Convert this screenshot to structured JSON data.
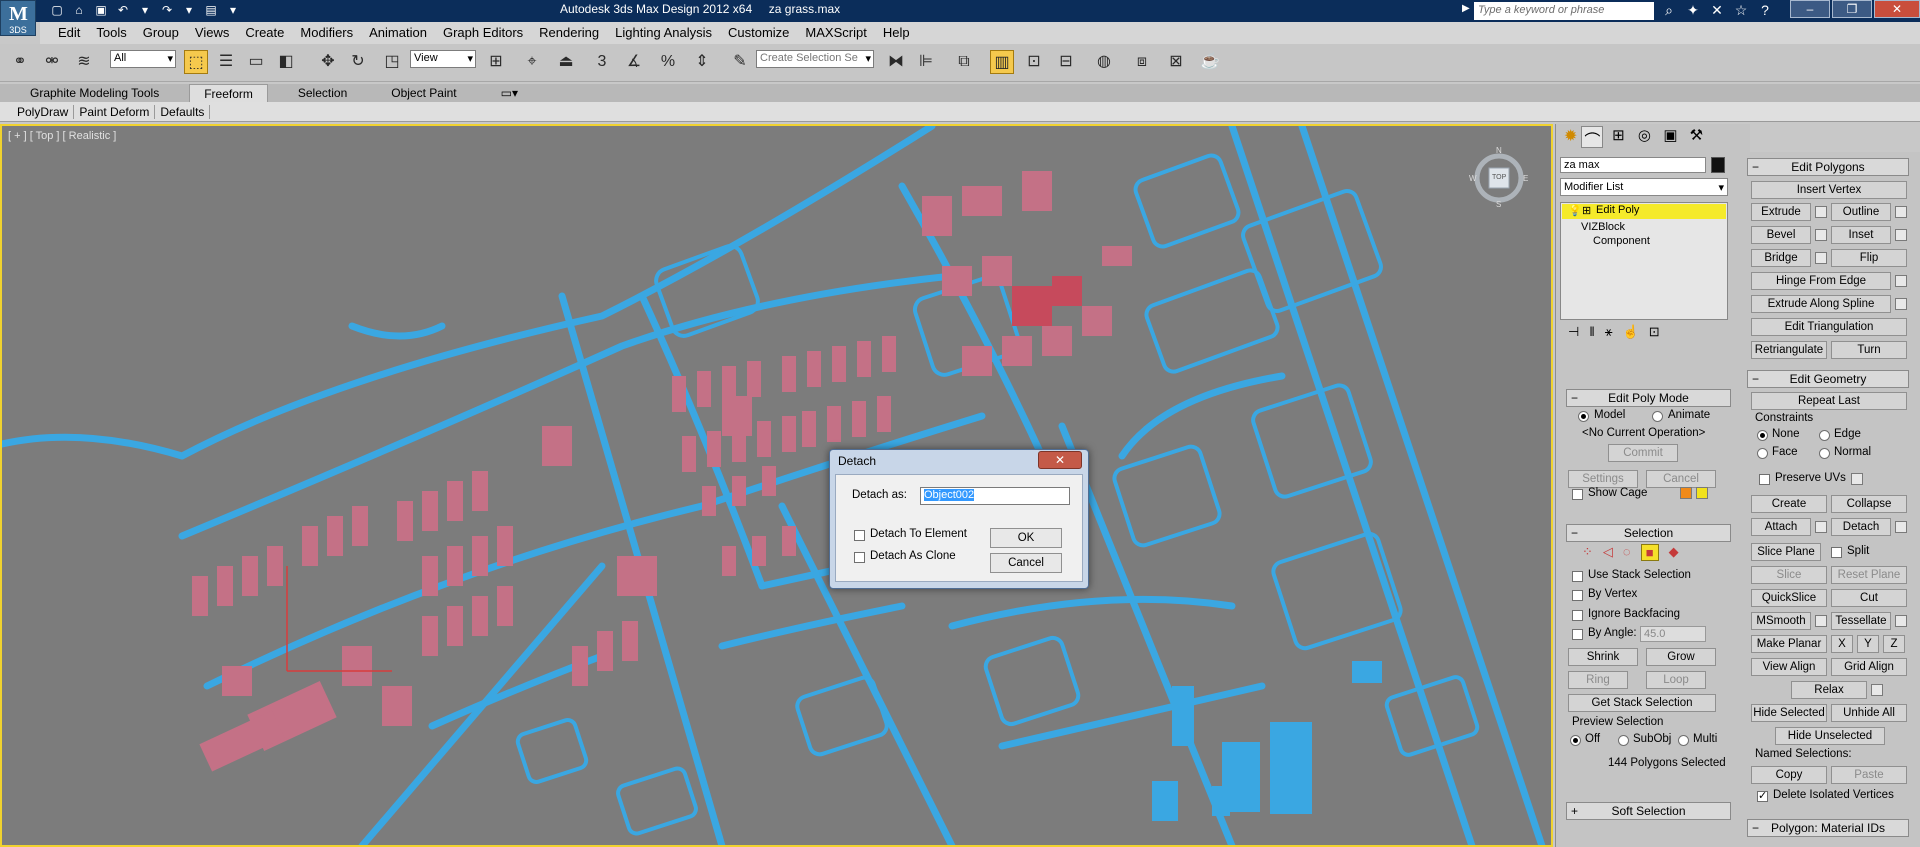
{
  "app": {
    "logo": "3DS",
    "title": "Autodesk 3ds Max Design 2012 x64     za grass.max"
  },
  "search": {
    "placeholder": "Type a keyword or phrase"
  },
  "menu": [
    "Edit",
    "Tools",
    "Group",
    "Views",
    "Create",
    "Modifiers",
    "Animation",
    "Graph Editors",
    "Rendering",
    "Lighting Analysis",
    "Customize",
    "MAXScript",
    "Help"
  ],
  "toolbar": {
    "filter": "All",
    "ref_coord": "View",
    "selection_set": "Create Selection Se",
    "snap_value": "3",
    "pct": "%"
  },
  "ribbon": {
    "tabs": [
      "Graphite Modeling Tools",
      "Freeform",
      "Selection",
      "Object Paint"
    ],
    "buttons": [
      "PolyDraw",
      "Paint Deform",
      "Defaults"
    ]
  },
  "viewport": {
    "label": "[ + ] [ Top ] [ Realistic ]",
    "viewcube_label": "TOP",
    "compass": [
      "N",
      "W",
      "E",
      "S"
    ]
  },
  "command_panel": {
    "object_name": "za max",
    "modifier_list": "Modifier List",
    "stack": [
      "Edit Poly",
      "VIZBlock",
      "Component"
    ],
    "edit_poly_mode": {
      "title": "Edit Poly Mode",
      "model": "Model",
      "animate": "Animate",
      "operation": "<No Current Operation>",
      "commit": "Commit",
      "settings": "Settings",
      "cancel": "Cancel",
      "show_cage": "Show Cage"
    },
    "selection": {
      "title": "Selection",
      "use_stack": "Use Stack Selection",
      "by_vertex": "By Vertex",
      "ignore_backfacing": "Ignore Backfacing",
      "by_angle": "By Angle:",
      "angle_value": "45.0",
      "shrink": "Shrink",
      "grow": "Grow",
      "ring": "Ring",
      "loop": "Loop",
      "get_stack": "Get Stack Selection",
      "preview": "Preview Selection",
      "off": "Off",
      "subobj": "SubObj",
      "multi": "Multi",
      "status": "144 Polygons Selected"
    },
    "soft_selection": "Soft Selection"
  },
  "edit_polygons": {
    "title": "Edit Polygons",
    "insert_vertex": "Insert Vertex",
    "extrude": "Extrude",
    "outline": "Outline",
    "bevel": "Bevel",
    "inset": "Inset",
    "bridge": "Bridge",
    "flip": "Flip",
    "hinge": "Hinge From Edge",
    "extrude_spline": "Extrude Along Spline",
    "edit_tri": "Edit Triangulation",
    "retriangulate": "Retriangulate",
    "turn": "Turn"
  },
  "edit_geometry": {
    "title": "Edit Geometry",
    "repeat_last": "Repeat Last",
    "constraints": "Constraints",
    "none": "None",
    "edge": "Edge",
    "face": "Face",
    "normal": "Normal",
    "preserve_uvs": "Preserve UVs",
    "create": "Create",
    "collapse": "Collapse",
    "attach": "Attach",
    "detach": "Detach",
    "slice_plane": "Slice Plane",
    "split": "Split",
    "slice": "Slice",
    "reset_plane": "Reset Plane",
    "quickslice": "QuickSlice",
    "cut": "Cut",
    "msmooth": "MSmooth",
    "tessellate": "Tessellate",
    "make_planar": "Make Planar",
    "x": "X",
    "y": "Y",
    "z": "Z",
    "view_align": "View Align",
    "grid_align": "Grid Align",
    "relax": "Relax",
    "hide_selected": "Hide Selected",
    "unhide_all": "Unhide All",
    "hide_unselected": "Hide Unselected",
    "named_selections": "Named Selections:",
    "copy": "Copy",
    "paste": "Paste",
    "delete_isolated": "Delete Isolated Vertices"
  },
  "material_ids": "Polygon: Material IDs",
  "dialog": {
    "title": "Detach",
    "close": "✕",
    "detach_as": "Detach as:",
    "name_value": "Object002",
    "to_element": "Detach To Element",
    "as_clone": "Detach As Clone",
    "ok": "OK",
    "cancel": "Cancel"
  },
  "colors": {
    "viewport_bg": "#7c7c7c",
    "roads": "#3aa7e2",
    "buildings": "#c47186",
    "selected_buildings": "#c64a5c",
    "active_border": "#f0d22e"
  }
}
